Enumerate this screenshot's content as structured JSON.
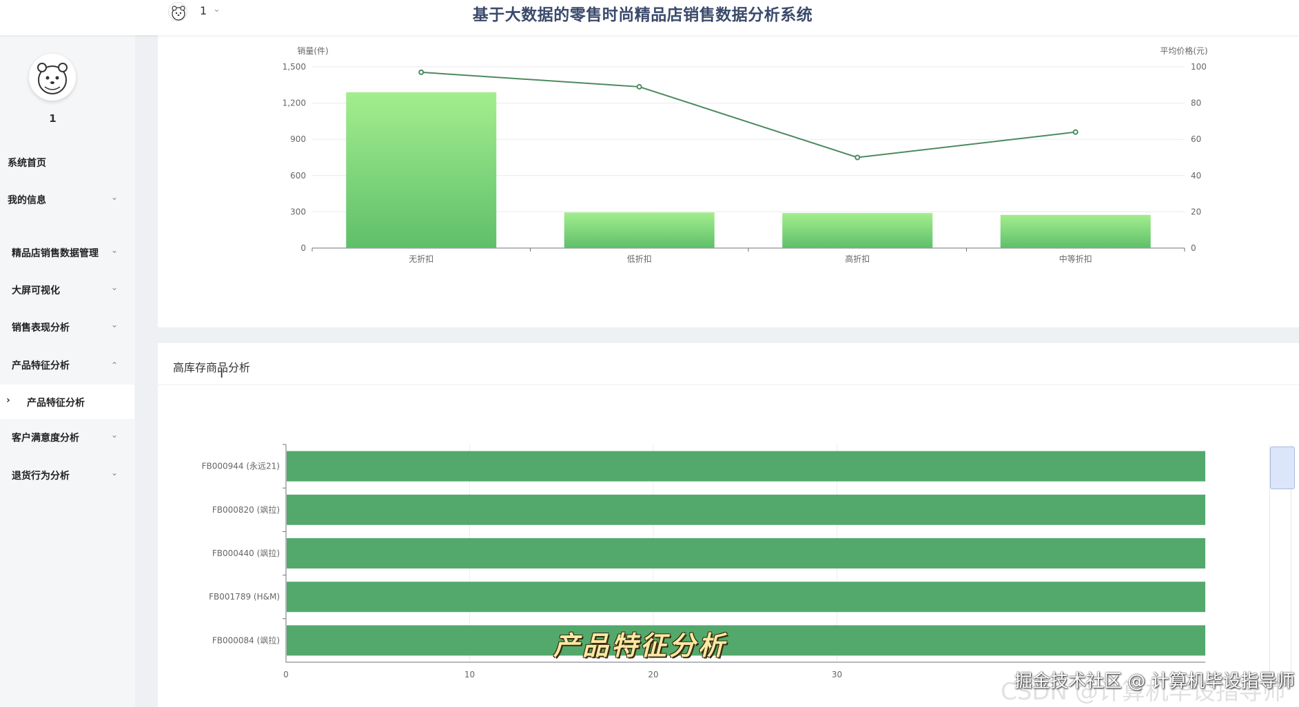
{
  "header": {
    "title": "基于大数据的零售时尚精品店销售数据分析系统",
    "username": "1"
  },
  "sidebar": {
    "username": "1",
    "items": [
      {
        "label": "系统首页"
      },
      {
        "label": "我的信息"
      },
      {
        "label": "精品店销售数据管理"
      },
      {
        "label": "大屏可视化"
      },
      {
        "label": "销售表现分析"
      },
      {
        "label": "产品特征分析"
      },
      {
        "label": "产品特征分析"
      },
      {
        "label": "客户满意度分析"
      },
      {
        "label": "退货行为分析"
      }
    ]
  },
  "chart_data": [
    {
      "type": "bar",
      "categories": [
        "无折扣",
        "低折扣",
        "高折扣",
        "中等折扣"
      ],
      "ylabel": "销量(件)",
      "ylabel_right": "平均价格(元)",
      "yticks": [
        "0",
        "300",
        "600",
        "900",
        "1,200",
        "1,500"
      ],
      "yticks_right": [
        "0",
        "20",
        "40",
        "60",
        "80",
        "100"
      ],
      "ylim": [
        0,
        1500
      ],
      "ylim_right": [
        0,
        100
      ],
      "series": [
        {
          "type": "bar",
          "values": [
            1290,
            295,
            290,
            275
          ],
          "color": "#7cd47a"
        },
        {
          "type": "line",
          "axis": "right",
          "values": [
            97,
            89,
            50,
            64
          ],
          "color": "#4a8a5e"
        }
      ]
    },
    {
      "type": "bar",
      "orientation": "horizontal",
      "title": "高库存商品分析",
      "categories": [
        "FB000944 (永远21)",
        "FB000820 (飒拉)",
        "FB000440 (飒拉)",
        "FB001789 (H&M)",
        "FB000084 (飒拉)"
      ],
      "values": [
        50,
        50,
        50,
        50,
        50
      ],
      "xticks": [
        "0",
        "10",
        "20",
        "30"
      ],
      "xlim": [
        0,
        50
      ],
      "color": "#52a96b"
    }
  ],
  "overlay": {
    "caption": "产品特征分析",
    "watermark_1": "掘金技术社区 @ 计算机毕设指导师",
    "watermark_2": "CSDN @计算机毕设指导师"
  }
}
